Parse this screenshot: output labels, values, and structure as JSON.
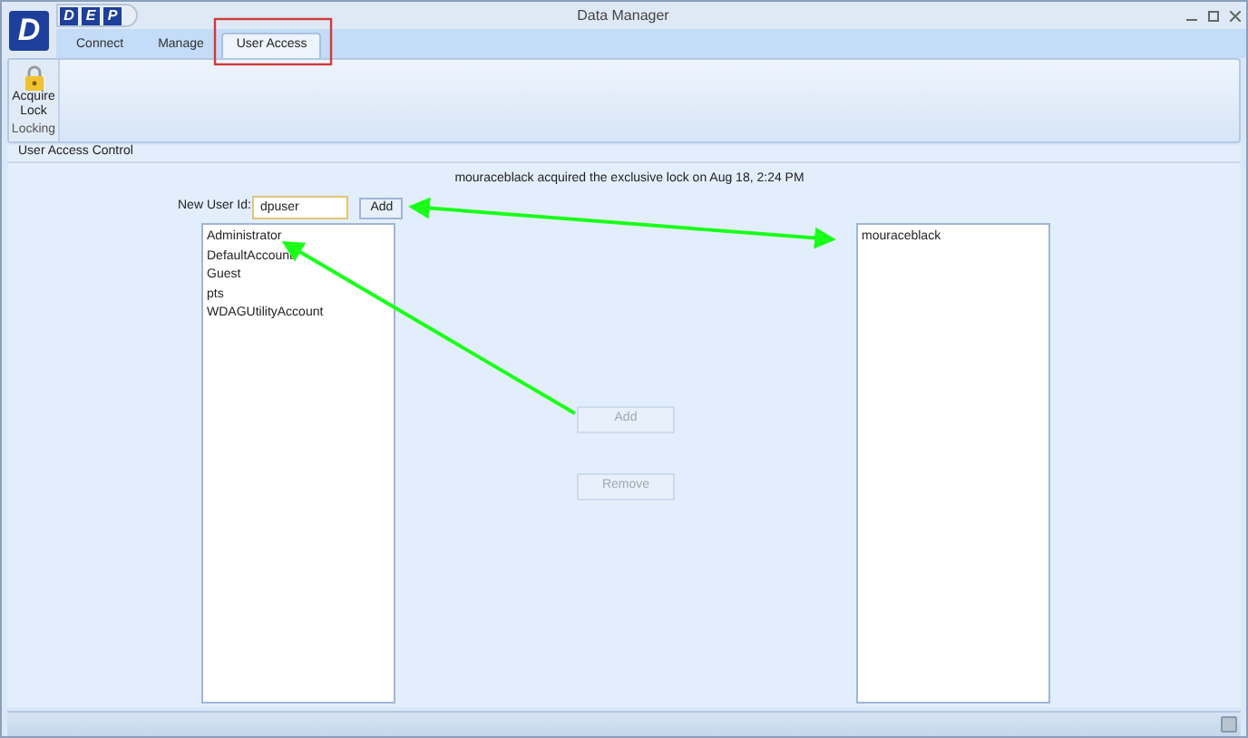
{
  "window": {
    "title": "Data Manager",
    "logo": "D"
  },
  "quick_access": [
    "D",
    "E",
    "P"
  ],
  "tabs": [
    {
      "label": "Connect",
      "selected": false
    },
    {
      "label": "Manage",
      "selected": false
    },
    {
      "label": "User Access",
      "selected": true
    }
  ],
  "ribbon": {
    "group": "Locking",
    "buttons": [
      {
        "label": "Acquire Lock"
      }
    ]
  },
  "section": {
    "title": "User Access Control"
  },
  "message": "mouraceblack acquired the exclusive lock on Aug 18, 2:24 PM",
  "new_user": {
    "label": "New User Id:",
    "value": "dpuser",
    "button": "Add"
  },
  "available_users": [
    "Administrator",
    "DefaultAccount",
    "Guest",
    "pts",
    "WDAGUtilityAccount"
  ],
  "actions": [
    {
      "label": "Add",
      "disabled": true
    },
    {
      "label": "Remove",
      "disabled": true
    }
  ],
  "granted_users": [
    "mouraceblack"
  ]
}
